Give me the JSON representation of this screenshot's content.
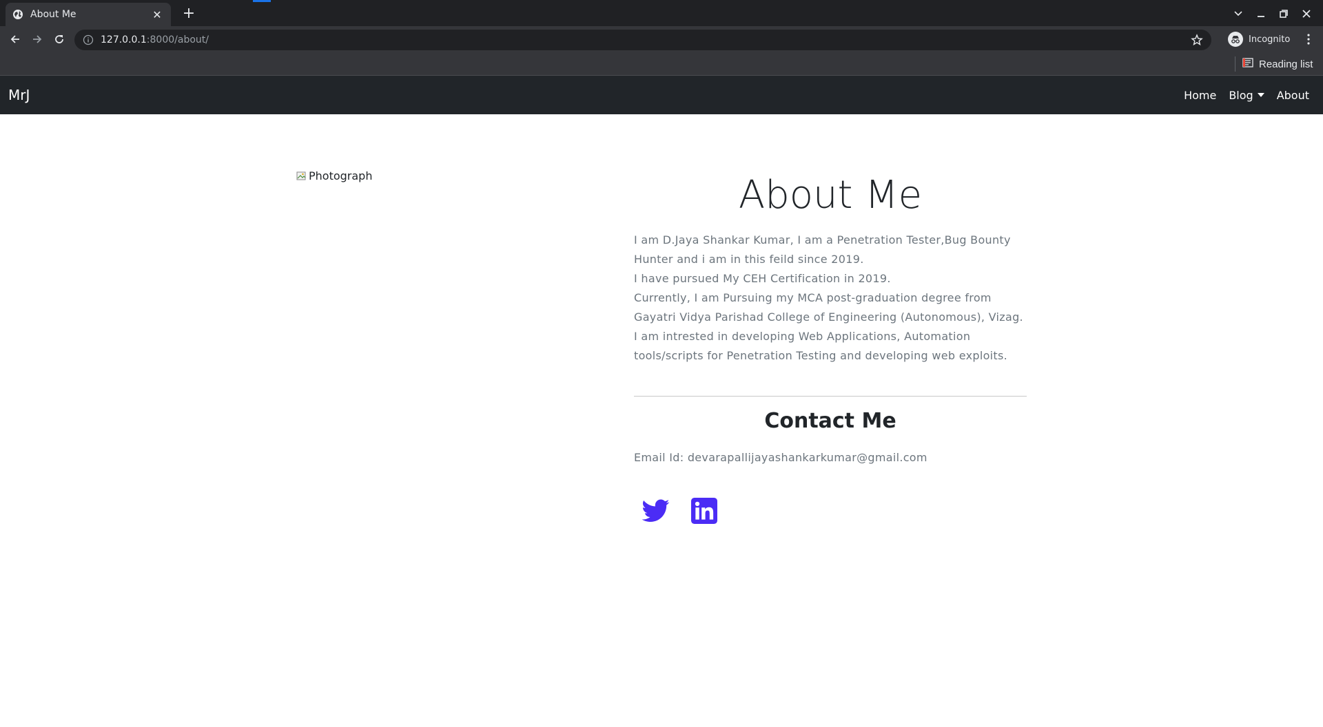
{
  "browser": {
    "tab_title": "About Me",
    "url_host": "127.0.0.1",
    "url_path": ":8000/about/",
    "incognito_label": "Incognito",
    "reading_list_label": "Reading list"
  },
  "navbar": {
    "brand": "MrJ",
    "links": [
      "Home",
      "Blog",
      "About"
    ]
  },
  "photo_alt": "Photograph",
  "about": {
    "title": "About Me",
    "paragraphs": [
      "I am D.Jaya Shankar Kumar, I am a Penetration Tester,Bug Bounty Hunter and i am in this feild since 2019.",
      "I have pursued My CEH Certification in 2019.",
      "Currently, I am Pursuing my MCA post-graduation degree from Gayatri Vidya Parishad College of Engineering (Autonomous), Vizag.",
      "I am intrested in developing Web Applications, Automation tools/scripts for Penetration Testing and developing web exploits."
    ]
  },
  "contact": {
    "title": "Contact Me",
    "email": "Email Id: devarapallijayashankarkumar@gmail.com"
  },
  "socials": {
    "icons": [
      "twitter-icon",
      "linkedin-icon"
    ],
    "accent_color": "#4b2cf5"
  },
  "colors": {
    "navbar_bg": "#212529",
    "muted_text": "#6c757d",
    "chrome_bg": "#35363a"
  }
}
